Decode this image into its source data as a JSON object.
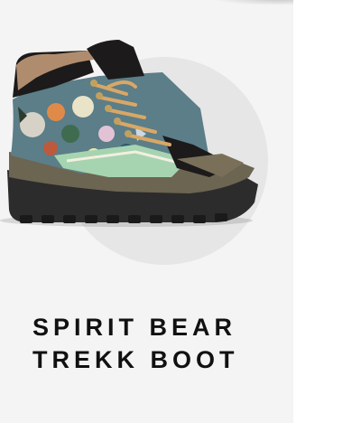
{
  "product": {
    "title_line1": "SPIRIT BEAR",
    "title_line2": "TREKK BOOT",
    "image_icon": "boot-image"
  },
  "colors": {
    "card_bg": "#f4f4f4",
    "circle": "#e6e6e6",
    "sole_dark": "#2c2c2c",
    "midsole_olive": "#6c6552",
    "suede_black": "#1c1a1a",
    "collar_tan": "#b08c6e",
    "mint": "#a6d4b0",
    "lace_gold": "#d9a766"
  }
}
